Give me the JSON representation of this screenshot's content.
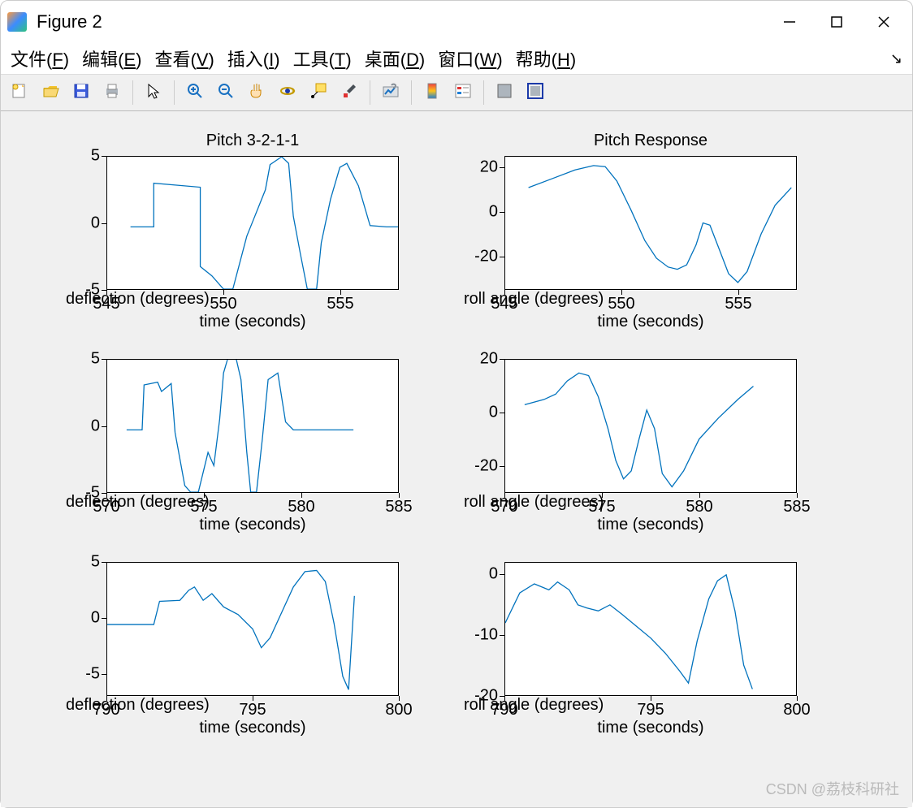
{
  "window": {
    "title": "Figure 2",
    "minimize_icon": "minimize-icon",
    "maximize_icon": "maximize-icon",
    "close_icon": "close-icon"
  },
  "menubar": {
    "items": [
      {
        "label": "文件",
        "key": "F"
      },
      {
        "label": "编辑",
        "key": "E"
      },
      {
        "label": "查看",
        "key": "V"
      },
      {
        "label": "插入",
        "key": "I"
      },
      {
        "label": "工具",
        "key": "T"
      },
      {
        "label": "桌面",
        "key": "D"
      },
      {
        "label": "窗口",
        "key": "W"
      },
      {
        "label": "帮助",
        "key": "H"
      }
    ]
  },
  "toolbar": {
    "groups": [
      [
        "new-figure-icon",
        "open-icon",
        "save-icon",
        "print-icon"
      ],
      [
        "pointer-icon"
      ],
      [
        "zoom-in-icon",
        "zoom-out-icon",
        "pan-icon",
        "rotate3d-icon",
        "datacursor-icon",
        "brush-icon"
      ],
      [
        "link-plot-icon"
      ],
      [
        "colorbar-icon",
        "legend-icon"
      ],
      [
        "hide-plottools-icon",
        "show-plottools-icon"
      ]
    ]
  },
  "watermark": "CSDN @荔枝科研社",
  "chart_data": [
    {
      "type": "line",
      "title": "Pitch 3-2-1-1",
      "xlabel": "time (seconds)",
      "ylabel": "deflection (degrees)",
      "xlim": [
        545,
        557.5
      ],
      "xticks": [
        545,
        550,
        555
      ],
      "ylim": [
        -5,
        5
      ],
      "yticks": [
        -5,
        0,
        5
      ],
      "x": [
        546,
        547,
        547,
        549,
        549,
        549.5,
        550,
        550.4,
        551,
        551.3,
        551.8,
        552,
        552.5,
        552.8,
        553,
        553.3,
        553.6,
        554,
        554.2,
        554.6,
        555,
        555.3,
        555.8,
        556.3,
        557,
        557.5
      ],
      "y": [
        -0.3,
        -0.3,
        3.0,
        2.7,
        -3.3,
        -4.0,
        -5.0,
        -5.0,
        -1.0,
        0.3,
        2.5,
        4.4,
        5.0,
        4.5,
        0.5,
        -2.3,
        -5.0,
        -5.0,
        -1.5,
        1.8,
        4.2,
        4.5,
        2.8,
        -0.2,
        -0.3,
        -0.3
      ]
    },
    {
      "type": "line",
      "title": "Pitch Response",
      "xlabel": "time (seconds)",
      "ylabel": "roll angle (degrees)",
      "xlim": [
        545,
        557.5
      ],
      "xticks": [
        545,
        550,
        555
      ],
      "ylim": [
        -35,
        25
      ],
      "yticks": [
        -20,
        0,
        20
      ],
      "x": [
        546,
        547,
        548,
        548.8,
        549.3,
        549.8,
        550.4,
        551,
        551.5,
        552,
        552.4,
        552.8,
        553.2,
        553.5,
        553.8,
        554.2,
        554.6,
        555,
        555.4,
        556,
        556.6,
        557.3
      ],
      "y": [
        11,
        15,
        19,
        21,
        20.5,
        14,
        1,
        -13,
        -21,
        -25,
        -26,
        -24,
        -15,
        -5,
        -6,
        -17,
        -28,
        -32,
        -27,
        -10,
        3,
        11
      ]
    },
    {
      "type": "line",
      "title": "",
      "xlabel": "time (seconds)",
      "ylabel": "deflection (degrees)",
      "xlim": [
        570,
        585
      ],
      "xticks": [
        570,
        575,
        580,
        585
      ],
      "ylim": [
        -5,
        5
      ],
      "yticks": [
        -5,
        0,
        5
      ],
      "x": [
        571,
        571.8,
        571.9,
        572.6,
        572.8,
        573.3,
        573.5,
        574,
        574.3,
        574.7,
        575.2,
        575.5,
        575.8,
        576,
        576.3,
        576.6,
        576.9,
        577.2,
        577.4,
        577.7,
        578,
        578.3,
        578.8,
        579.2,
        579.6,
        582.7
      ],
      "y": [
        -0.3,
        -0.3,
        3.1,
        3.3,
        2.6,
        3.2,
        -0.5,
        -4.5,
        -5.0,
        -5.0,
        -2.0,
        -3.0,
        0.5,
        4.0,
        5.5,
        5.4,
        3.5,
        -2.0,
        -5.0,
        -5.0,
        -1.0,
        3.5,
        4.0,
        0.3,
        -0.3,
        -0.3
      ]
    },
    {
      "type": "line",
      "title": "",
      "xlabel": "time (seconds)",
      "ylabel": "roll angle (degrees)",
      "xlim": [
        570,
        585
      ],
      "xticks": [
        570,
        575,
        580,
        585
      ],
      "ylim": [
        -30,
        20
      ],
      "yticks": [
        -20,
        0,
        20
      ],
      "x": [
        571,
        572,
        572.6,
        573.2,
        573.8,
        574.3,
        574.8,
        575.3,
        575.7,
        576.1,
        576.5,
        576.9,
        577.3,
        577.7,
        578.1,
        578.6,
        579.2,
        580,
        581,
        582,
        582.8
      ],
      "y": [
        3,
        5,
        7,
        12,
        15,
        14,
        6,
        -6,
        -18,
        -25,
        -22,
        -10,
        1,
        -6,
        -23,
        -28,
        -22,
        -10,
        -2,
        5,
        10
      ]
    },
    {
      "type": "line",
      "title": "",
      "xlabel": "time (seconds)",
      "ylabel": "deflection (degrees)",
      "xlim": [
        790,
        800
      ],
      "xticks": [
        790,
        795,
        800
      ],
      "ylim": [
        -7,
        5
      ],
      "yticks": [
        -5,
        0,
        5
      ],
      "x": [
        790,
        791.6,
        791.8,
        792.5,
        792.8,
        793,
        793.3,
        793.6,
        794,
        794.5,
        795,
        795.3,
        795.6,
        796,
        796.4,
        796.8,
        797.2,
        797.5,
        797.8,
        798.1,
        798.3,
        798.5
      ],
      "y": [
        -0.6,
        -0.6,
        1.5,
        1.6,
        2.5,
        2.8,
        1.6,
        2.2,
        1.0,
        0.3,
        -1.0,
        -2.7,
        -1.8,
        0.5,
        2.8,
        4.2,
        4.3,
        3.3,
        -0.5,
        -5.3,
        -6.5,
        2.0
      ]
    },
    {
      "type": "line",
      "title": "",
      "xlabel": "time (seconds)",
      "ylabel": "roll angle (degrees)",
      "xlim": [
        790,
        800
      ],
      "xticks": [
        790,
        795,
        800
      ],
      "ylim": [
        -20,
        2
      ],
      "yticks": [
        -20,
        -10,
        0
      ],
      "x": [
        790,
        790.5,
        791,
        791.5,
        791.8,
        792.2,
        792.5,
        792.8,
        793.2,
        793.6,
        794,
        794.5,
        795,
        795.5,
        796,
        796.3,
        796.6,
        797,
        797.3,
        797.6,
        797.9,
        798.2,
        798.5
      ],
      "y": [
        -8,
        -3,
        -1.5,
        -2.5,
        -1.2,
        -2.5,
        -5,
        -5.5,
        -6,
        -5,
        -6.5,
        -8.5,
        -10.5,
        -13,
        -16,
        -18,
        -11,
        -4,
        -1,
        0,
        -6,
        -15,
        -19
      ]
    }
  ]
}
